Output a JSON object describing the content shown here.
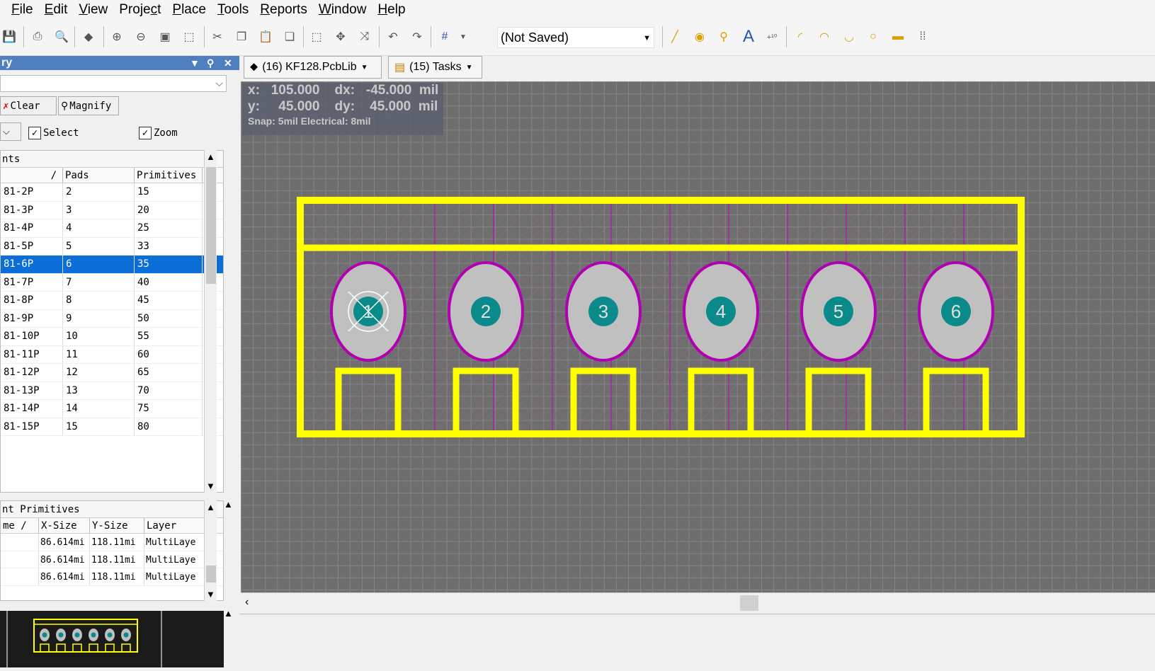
{
  "menu": [
    "File",
    "Edit",
    "View",
    "Project",
    "Place",
    "Tools",
    "Reports",
    "Window",
    "Help"
  ],
  "toolbar": {
    "layer_combo": "(Not Saved)"
  },
  "panel": {
    "title": "ry",
    "clear_label": "Clear",
    "magnify_label": "Magnify",
    "select_label": "Select",
    "zoom_label": "Zoom",
    "components_caption": "nts",
    "components_columns": [
      "/",
      "Pads",
      "Primitives"
    ],
    "components": [
      {
        "name": "81-2P",
        "pads": "2",
        "prims": "15"
      },
      {
        "name": "81-3P",
        "pads": "3",
        "prims": "20"
      },
      {
        "name": "81-4P",
        "pads": "4",
        "prims": "25"
      },
      {
        "name": "81-5P",
        "pads": "5",
        "prims": "33"
      },
      {
        "name": "81-6P",
        "pads": "6",
        "prims": "35",
        "selected": true
      },
      {
        "name": "81-7P",
        "pads": "7",
        "prims": "40"
      },
      {
        "name": "81-8P",
        "pads": "8",
        "prims": "45"
      },
      {
        "name": "81-9P",
        "pads": "9",
        "prims": "50"
      },
      {
        "name": "81-10P",
        "pads": "10",
        "prims": "55"
      },
      {
        "name": "81-11P",
        "pads": "11",
        "prims": "60"
      },
      {
        "name": "81-12P",
        "pads": "12",
        "prims": "65"
      },
      {
        "name": "81-13P",
        "pads": "13",
        "prims": "70"
      },
      {
        "name": "81-14P",
        "pads": "14",
        "prims": "75"
      },
      {
        "name": "81-15P",
        "pads": "15",
        "prims": "80"
      }
    ],
    "primitives_caption": "nt Primitives",
    "primitives_columns": [
      "me /",
      "X-Size",
      "Y-Size",
      "Layer"
    ],
    "primitives": [
      {
        "name": "",
        "x": "86.614mi",
        "y": "118.11mi",
        "layer": "MultiLaye"
      },
      {
        "name": "",
        "x": "86.614mi",
        "y": "118.11mi",
        "layer": "MultiLaye"
      },
      {
        "name": "",
        "x": "86.614mi",
        "y": "118.11mi",
        "layer": "MultiLaye"
      }
    ]
  },
  "tabs": {
    "lib": "(16) KF128.PcbLib",
    "tasks": "(15) Tasks"
  },
  "hud": {
    "line1": "x:   105.000    dx:   -45.000  mil",
    "line2": "y:     45.000    dy:    45.000  mil",
    "line3": "Snap: 5mil Electrical: 8mil"
  },
  "pads": [
    "1",
    "2",
    "3",
    "4",
    "5",
    "6"
  ],
  "colors": {
    "outline": "#ffff00",
    "pad_gray": "#c0c0c0",
    "pad_center": "#0a8a8a",
    "keepout": "#b000b0",
    "selection": "#0b6dd6"
  }
}
